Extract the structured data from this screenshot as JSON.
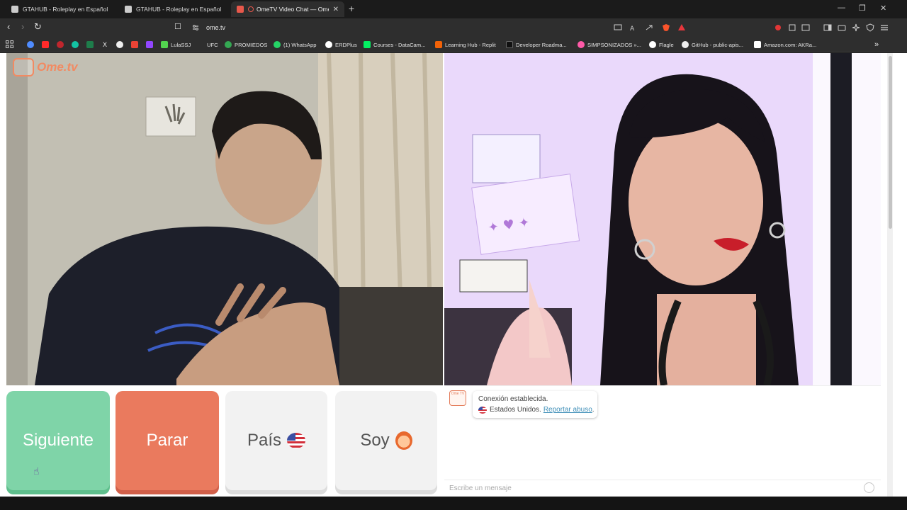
{
  "browser": {
    "tabs": [
      {
        "title": "GTAHUB - Roleplay en Español",
        "active": false
      },
      {
        "title": "GTAHUB - Roleplay en Español",
        "active": false
      },
      {
        "title": "OmeTV Video Chat — Omeg",
        "active": true
      }
    ],
    "new_tab": "+",
    "url": "ome.tv",
    "bookmarks": [
      {
        "label": "",
        "color": "#4f8cff"
      },
      {
        "label": "",
        "color": "#ff2a2a"
      },
      {
        "label": "",
        "color": "#c0262d"
      },
      {
        "label": "",
        "color": "#13c3a3"
      },
      {
        "label": "",
        "color": "#1e7d4b"
      },
      {
        "label": "",
        "color": "#dddddd",
        "glyph": "X"
      },
      {
        "label": "",
        "color": "#eeeeee"
      },
      {
        "label": "",
        "color": "#ea4335"
      },
      {
        "label": "",
        "color": "#9146ff"
      },
      {
        "label": "LulaSSJ",
        "color": "#52d24f"
      },
      {
        "label": "UFC",
        "color": "#2e2e2e"
      },
      {
        "label": "PROMIEDOS",
        "color": "#34a853"
      },
      {
        "label": "(1) WhatsApp",
        "color": "#25d366"
      },
      {
        "label": "ERDPlus",
        "color": "#ffffff"
      },
      {
        "label": "Courses - DataCam...",
        "color": "#03ef62"
      },
      {
        "label": "Learning Hub - Replit",
        "color": "#f26207"
      },
      {
        "label": "Developer Roadma...",
        "color": "#111111"
      },
      {
        "label": "SIMPSONIZADOS »...",
        "color": "#ff5aa8"
      },
      {
        "label": "Flagle",
        "color": "#ffffff"
      },
      {
        "label": "GitHub - public-apis...",
        "color": "#eeeeee"
      },
      {
        "label": "Amazon.com: AKRa...",
        "color": "#ffffff"
      }
    ],
    "bookmarks_more": "»"
  },
  "page": {
    "logo_text": "Ome.tv",
    "buttons": {
      "next": "Siguiente",
      "stop": "Parar",
      "country": "País",
      "gender": "Soy"
    },
    "chat": {
      "avatar_text": "Ome TV",
      "connection": "Conexión establecida.",
      "country": "Estados Unidos.",
      "report": "Reportar abuso",
      "report_period": ".",
      "placeholder": "Escribe un mensaje"
    }
  },
  "colors": {
    "next_button": "#7fd4a8",
    "stop_button": "#ea7a5e",
    "neutral_button": "#f2f2f2",
    "brand": "#f28a62",
    "link": "#3f8fb8"
  }
}
